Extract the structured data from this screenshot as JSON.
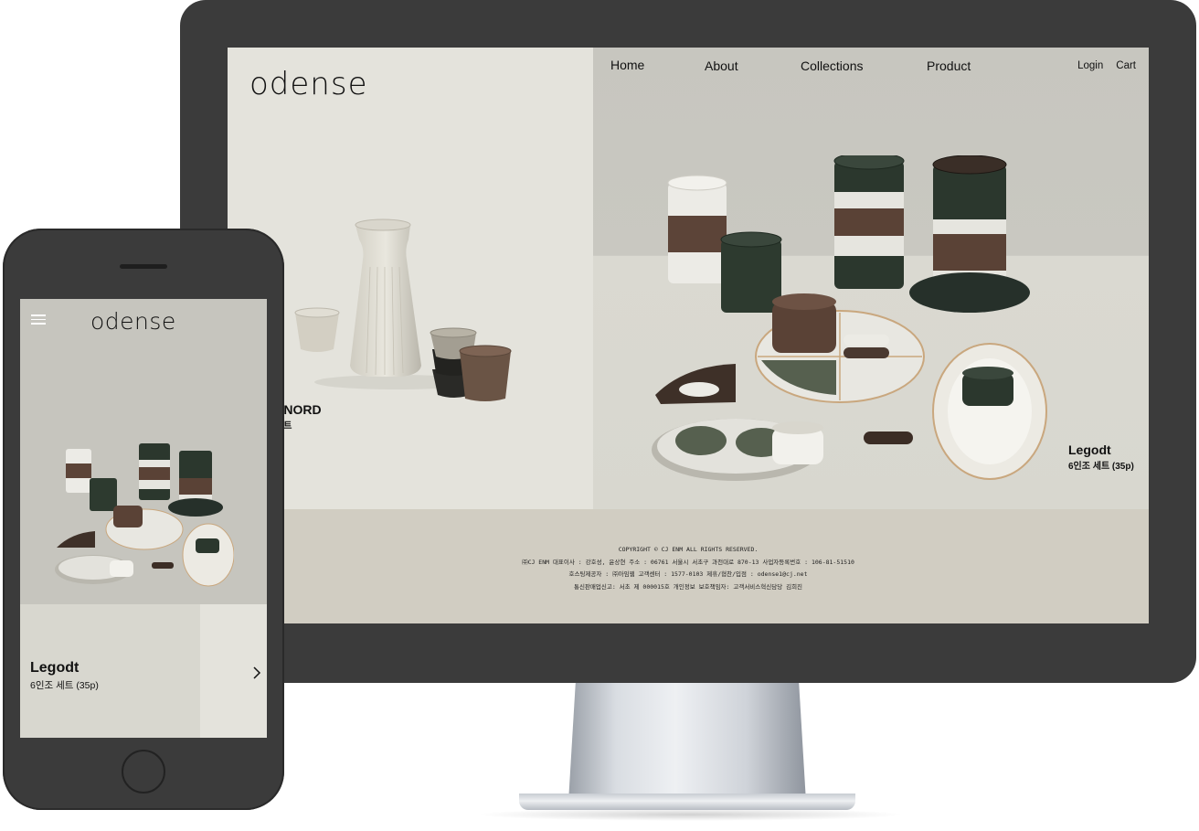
{
  "desktop": {
    "logo": "odense",
    "nav": {
      "home": "Home",
      "about": "About",
      "collections": "Collections",
      "product": "Product"
    },
    "utility": {
      "login": "Login",
      "cart": "Cart"
    },
    "slides": {
      "left": {
        "title": "r NORD",
        "subtitle": "세트"
      },
      "right": {
        "title": "Legodt",
        "subtitle": "6인조 세트 (35p)"
      }
    },
    "footer": {
      "copyright": "COPYRIGHT © CJ ENM ALL RIGHTS RESERVED.",
      "line1": "㈜CJ ENM 대표이사 : 강호성, 윤상현 주소 : 06761 서울시 서초구 과천대로 870-13 사업자등록번호 : 106-81-51510",
      "line2": "호스팅제공자 : ㈜아임웹 고객센터 : 1577-0103 제휴/협찬/입점 : odense1@cj.net",
      "line3": "통신판매업신고: 서초 제 000015호 개인정보 보호책임자: 고객서비스혁신담당 김희진"
    }
  },
  "mobile": {
    "logo": "odense",
    "slide": {
      "title": "Legodt",
      "subtitle": "6인조 세트 (35p)"
    }
  },
  "icons": {
    "menu": "hamburger-menu-icon",
    "next": "chevron-right-icon"
  },
  "colors": {
    "device_frame": "#3b3b3b",
    "left_panel_bg": "#e4e3dc",
    "hero_bg": "#c8c7c0",
    "footer_bg": "#d1cdc2"
  }
}
